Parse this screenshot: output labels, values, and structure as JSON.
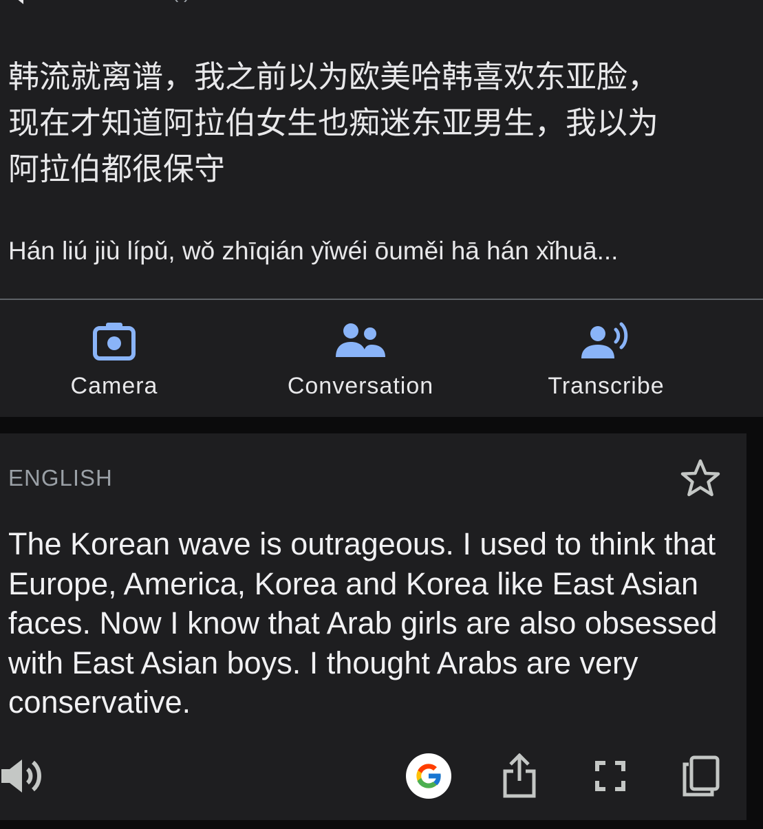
{
  "source": {
    "hidden_language_fragment": "(            )",
    "text_lines": [
      "韩流就离谱，我之前以为欧美哈韩喜欢东亚脸，",
      "现在才知道阿拉伯女生也痴迷东亚男生，我以为",
      "阿拉伯都很保守"
    ],
    "pinyin": "Hán liú jiù lípǔ, wǒ zhīqián yǐwéi ōuměi hā hán xǐhuā..."
  },
  "tools": {
    "camera_label": "Camera",
    "conversation_label": "Conversation",
    "transcribe_label": "Transcribe"
  },
  "translation": {
    "language_label": "ENGLISH",
    "text": "The Korean wave is outrageous. I used to think that Europe, America, Korea and Korea like East Asian faces. Now I know that Arab girls are also obsessed with East Asian boys. I thought Arabs are very conservative."
  },
  "icons": {
    "speaker": "speaker-icon",
    "close": "close-icon",
    "camera": "camera-icon",
    "conversation": "people-icon",
    "transcribe": "voice-person-icon",
    "star": "star-outline-icon",
    "google": "google-logo-icon",
    "share": "share-icon",
    "fullscreen": "fullscreen-icon",
    "copy": "copy-icon"
  },
  "colors": {
    "accent": "#8ab4f8",
    "card_bg": "#1e1e20",
    "page_bg": "#0b0b0c",
    "muted": "#9aa0a6"
  }
}
